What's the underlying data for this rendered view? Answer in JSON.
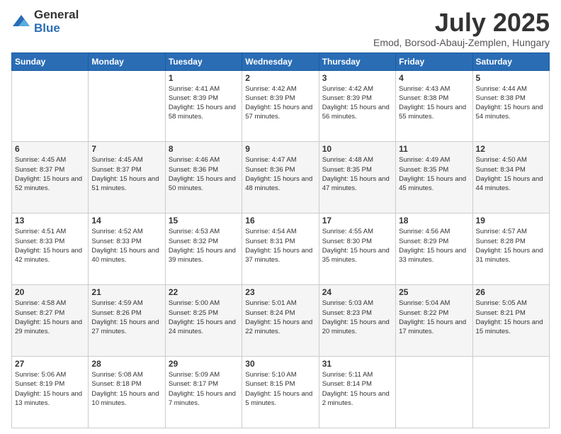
{
  "header": {
    "logo_general": "General",
    "logo_blue": "Blue",
    "month_title": "July 2025",
    "location": "Emod, Borsod-Abauj-Zemplen, Hungary"
  },
  "days_of_week": [
    "Sunday",
    "Monday",
    "Tuesday",
    "Wednesday",
    "Thursday",
    "Friday",
    "Saturday"
  ],
  "weeks": [
    [
      {
        "day": "",
        "info": ""
      },
      {
        "day": "",
        "info": ""
      },
      {
        "day": "1",
        "info": "Sunrise: 4:41 AM\nSunset: 8:39 PM\nDaylight: 15 hours\nand 58 minutes."
      },
      {
        "day": "2",
        "info": "Sunrise: 4:42 AM\nSunset: 8:39 PM\nDaylight: 15 hours\nand 57 minutes."
      },
      {
        "day": "3",
        "info": "Sunrise: 4:42 AM\nSunset: 8:39 PM\nDaylight: 15 hours\nand 56 minutes."
      },
      {
        "day": "4",
        "info": "Sunrise: 4:43 AM\nSunset: 8:38 PM\nDaylight: 15 hours\nand 55 minutes."
      },
      {
        "day": "5",
        "info": "Sunrise: 4:44 AM\nSunset: 8:38 PM\nDaylight: 15 hours\nand 54 minutes."
      }
    ],
    [
      {
        "day": "6",
        "info": "Sunrise: 4:45 AM\nSunset: 8:37 PM\nDaylight: 15 hours\nand 52 minutes."
      },
      {
        "day": "7",
        "info": "Sunrise: 4:45 AM\nSunset: 8:37 PM\nDaylight: 15 hours\nand 51 minutes."
      },
      {
        "day": "8",
        "info": "Sunrise: 4:46 AM\nSunset: 8:36 PM\nDaylight: 15 hours\nand 50 minutes."
      },
      {
        "day": "9",
        "info": "Sunrise: 4:47 AM\nSunset: 8:36 PM\nDaylight: 15 hours\nand 48 minutes."
      },
      {
        "day": "10",
        "info": "Sunrise: 4:48 AM\nSunset: 8:35 PM\nDaylight: 15 hours\nand 47 minutes."
      },
      {
        "day": "11",
        "info": "Sunrise: 4:49 AM\nSunset: 8:35 PM\nDaylight: 15 hours\nand 45 minutes."
      },
      {
        "day": "12",
        "info": "Sunrise: 4:50 AM\nSunset: 8:34 PM\nDaylight: 15 hours\nand 44 minutes."
      }
    ],
    [
      {
        "day": "13",
        "info": "Sunrise: 4:51 AM\nSunset: 8:33 PM\nDaylight: 15 hours\nand 42 minutes."
      },
      {
        "day": "14",
        "info": "Sunrise: 4:52 AM\nSunset: 8:33 PM\nDaylight: 15 hours\nand 40 minutes."
      },
      {
        "day": "15",
        "info": "Sunrise: 4:53 AM\nSunset: 8:32 PM\nDaylight: 15 hours\nand 39 minutes."
      },
      {
        "day": "16",
        "info": "Sunrise: 4:54 AM\nSunset: 8:31 PM\nDaylight: 15 hours\nand 37 minutes."
      },
      {
        "day": "17",
        "info": "Sunrise: 4:55 AM\nSunset: 8:30 PM\nDaylight: 15 hours\nand 35 minutes."
      },
      {
        "day": "18",
        "info": "Sunrise: 4:56 AM\nSunset: 8:29 PM\nDaylight: 15 hours\nand 33 minutes."
      },
      {
        "day": "19",
        "info": "Sunrise: 4:57 AM\nSunset: 8:28 PM\nDaylight: 15 hours\nand 31 minutes."
      }
    ],
    [
      {
        "day": "20",
        "info": "Sunrise: 4:58 AM\nSunset: 8:27 PM\nDaylight: 15 hours\nand 29 minutes."
      },
      {
        "day": "21",
        "info": "Sunrise: 4:59 AM\nSunset: 8:26 PM\nDaylight: 15 hours\nand 27 minutes."
      },
      {
        "day": "22",
        "info": "Sunrise: 5:00 AM\nSunset: 8:25 PM\nDaylight: 15 hours\nand 24 minutes."
      },
      {
        "day": "23",
        "info": "Sunrise: 5:01 AM\nSunset: 8:24 PM\nDaylight: 15 hours\nand 22 minutes."
      },
      {
        "day": "24",
        "info": "Sunrise: 5:03 AM\nSunset: 8:23 PM\nDaylight: 15 hours\nand 20 minutes."
      },
      {
        "day": "25",
        "info": "Sunrise: 5:04 AM\nSunset: 8:22 PM\nDaylight: 15 hours\nand 17 minutes."
      },
      {
        "day": "26",
        "info": "Sunrise: 5:05 AM\nSunset: 8:21 PM\nDaylight: 15 hours\nand 15 minutes."
      }
    ],
    [
      {
        "day": "27",
        "info": "Sunrise: 5:06 AM\nSunset: 8:19 PM\nDaylight: 15 hours\nand 13 minutes."
      },
      {
        "day": "28",
        "info": "Sunrise: 5:08 AM\nSunset: 8:18 PM\nDaylight: 15 hours\nand 10 minutes."
      },
      {
        "day": "29",
        "info": "Sunrise: 5:09 AM\nSunset: 8:17 PM\nDaylight: 15 hours\nand 7 minutes."
      },
      {
        "day": "30",
        "info": "Sunrise: 5:10 AM\nSunset: 8:15 PM\nDaylight: 15 hours\nand 5 minutes."
      },
      {
        "day": "31",
        "info": "Sunrise: 5:11 AM\nSunset: 8:14 PM\nDaylight: 15 hours\nand 2 minutes."
      },
      {
        "day": "",
        "info": ""
      },
      {
        "day": "",
        "info": ""
      }
    ]
  ]
}
